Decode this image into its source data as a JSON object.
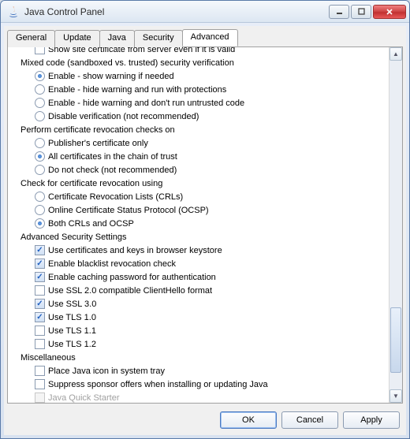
{
  "window": {
    "title": "Java Control Panel"
  },
  "tabs": [
    {
      "label": "General"
    },
    {
      "label": "Update"
    },
    {
      "label": "Java"
    },
    {
      "label": "Security"
    },
    {
      "label": "Advanced"
    }
  ],
  "tree": {
    "partial_top": "Show site certificate from server even if it is valid",
    "groups": [
      {
        "heading": "Mixed code (sandboxed vs. trusted) security verification",
        "type": "radio",
        "items": [
          {
            "label": "Enable - show warning if needed",
            "selected": true
          },
          {
            "label": "Enable - hide warning and run with protections",
            "selected": false
          },
          {
            "label": "Enable - hide warning and don't run untrusted code",
            "selected": false
          },
          {
            "label": "Disable verification (not recommended)",
            "selected": false
          }
        ]
      },
      {
        "heading": "Perform certificate revocation checks on",
        "type": "radio",
        "items": [
          {
            "label": "Publisher's certificate only",
            "selected": false
          },
          {
            "label": "All certificates in the chain of trust",
            "selected": true
          },
          {
            "label": "Do not check (not recommended)",
            "selected": false
          }
        ]
      },
      {
        "heading": "Check for certificate revocation using",
        "type": "radio",
        "items": [
          {
            "label": "Certificate Revocation Lists (CRLs)",
            "selected": false
          },
          {
            "label": "Online Certificate Status Protocol (OCSP)",
            "selected": false
          },
          {
            "label": "Both CRLs and OCSP",
            "selected": true
          }
        ]
      },
      {
        "heading": "Advanced Security Settings",
        "type": "check",
        "items": [
          {
            "label": "Use certificates and keys in browser keystore",
            "selected": true
          },
          {
            "label": "Enable blacklist revocation check",
            "selected": true
          },
          {
            "label": "Enable caching password for authentication",
            "selected": true
          },
          {
            "label": "Use SSL 2.0 compatible ClientHello format",
            "selected": false
          },
          {
            "label": "Use SSL 3.0",
            "selected": true
          },
          {
            "label": "Use TLS 1.0",
            "selected": true
          },
          {
            "label": "Use TLS 1.1",
            "selected": false
          },
          {
            "label": "Use TLS 1.2",
            "selected": false
          }
        ]
      },
      {
        "heading": "Miscellaneous",
        "type": "check",
        "items": [
          {
            "label": "Place Java icon in system tray",
            "selected": false
          },
          {
            "label": "Suppress sponsor offers when installing or updating Java",
            "selected": false
          },
          {
            "label": "Java Quick Starter",
            "selected": false,
            "disabled": true
          }
        ]
      }
    ]
  },
  "buttons": {
    "ok": "OK",
    "cancel": "Cancel",
    "apply": "Apply"
  }
}
